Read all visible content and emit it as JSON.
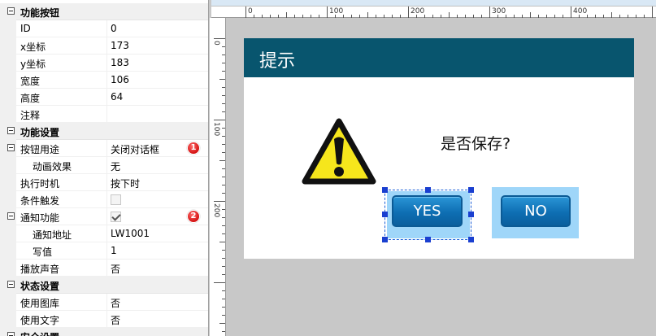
{
  "property_grid": {
    "rows": [
      {
        "kind": "category",
        "label": "功能按钮"
      },
      {
        "kind": "prop",
        "label": "ID",
        "value": "0"
      },
      {
        "kind": "prop",
        "label": "x坐标",
        "value": "173"
      },
      {
        "kind": "prop",
        "label": "y坐标",
        "value": "183"
      },
      {
        "kind": "prop",
        "label": "宽度",
        "value": "106"
      },
      {
        "kind": "prop",
        "label": "高度",
        "value": "64"
      },
      {
        "kind": "prop",
        "label": "注释",
        "value": ""
      },
      {
        "kind": "category",
        "label": "功能设置"
      },
      {
        "kind": "parent",
        "label": "按钮用途",
        "value": "关闭对话框",
        "badge": "1"
      },
      {
        "kind": "child",
        "label": "动画效果",
        "value": "无"
      },
      {
        "kind": "prop",
        "label": "执行时机",
        "value": "按下时"
      },
      {
        "kind": "check",
        "label": "条件触发",
        "checked": false
      },
      {
        "kind": "parent-check",
        "label": "通知功能",
        "checked": true,
        "badge": "2"
      },
      {
        "kind": "child",
        "label": "通知地址",
        "value": "LW1001"
      },
      {
        "kind": "child",
        "label": "写值",
        "value": "1"
      },
      {
        "kind": "prop",
        "label": "播放声音",
        "value": "否"
      },
      {
        "kind": "category",
        "label": "状态设置"
      },
      {
        "kind": "prop",
        "label": "使用图库",
        "value": "否"
      },
      {
        "kind": "prop",
        "label": "使用文字",
        "value": "否"
      },
      {
        "kind": "category",
        "label": "安全设置"
      }
    ]
  },
  "ruler": {
    "top_labels": [
      "0",
      "100",
      "200",
      "300",
      "400"
    ],
    "left_labels": [
      "0",
      "100",
      "200"
    ]
  },
  "dialog": {
    "title": "提示",
    "message": "是否保存?",
    "yes_label": "YES",
    "no_label": "NO",
    "title_bar_color": "#08556e",
    "warning_icon": "warning-triangle-icon"
  }
}
